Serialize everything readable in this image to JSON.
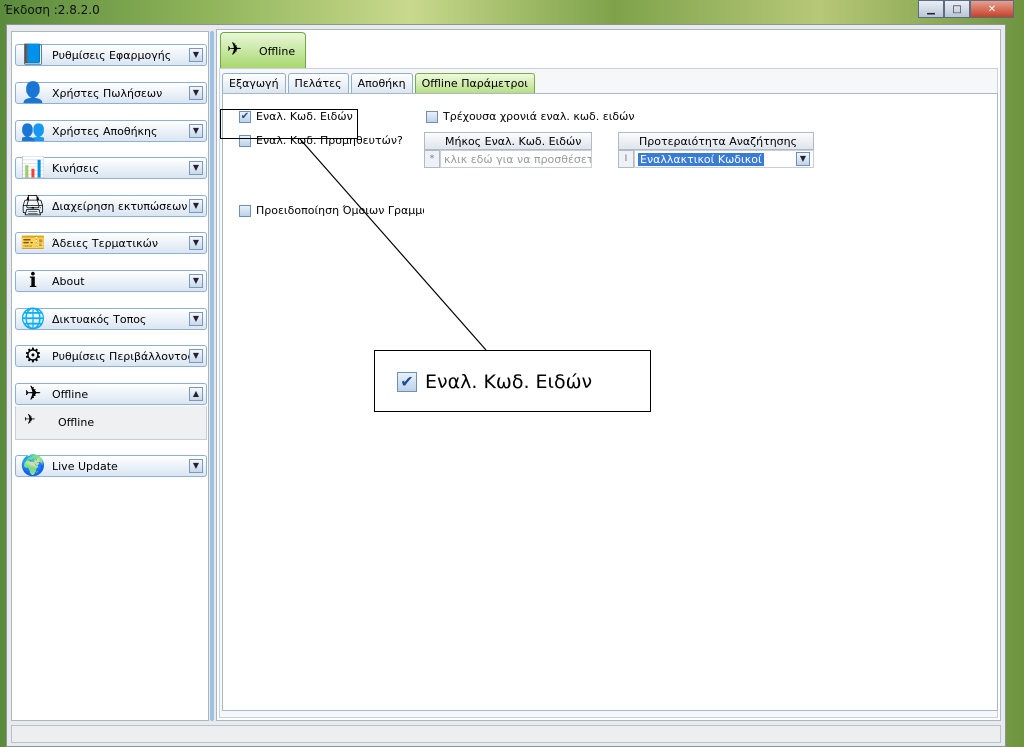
{
  "window": {
    "title": "Έκδοση :2.8.2.0",
    "minimize_glyph": "▁",
    "maximize_glyph": "□",
    "close_glyph": "✕"
  },
  "sidebar": {
    "items": [
      {
        "label": "Ρυθμίσεις Εφαρμογής",
        "icon": "settings-book-icon",
        "glyph": "📘"
      },
      {
        "label": "Χρήστες Πωλήσεων",
        "icon": "sales-user-icon",
        "glyph": "👤"
      },
      {
        "label": "Χρήστες Αποθήκης",
        "icon": "warehouse-users-icon",
        "glyph": "👥"
      },
      {
        "label": "Κινήσεις",
        "icon": "chart-icon",
        "glyph": "📊"
      },
      {
        "label": "Διαχείρηση εκτυπώσεων",
        "icon": "printer-icon",
        "glyph": "🖨"
      },
      {
        "label": "Άδειες Τερματικών",
        "icon": "license-icon",
        "glyph": "🎫"
      },
      {
        "label": "About",
        "icon": "info-icon",
        "glyph": "ℹ"
      },
      {
        "label": "Δικτυακός Τοπος",
        "icon": "web-icon",
        "glyph": "🌐"
      },
      {
        "label": "Ρυθμίσεις Περιβάλλοντος",
        "icon": "environment-settings-icon",
        "glyph": "⚙"
      },
      {
        "label": "Offline",
        "icon": "offline-icon",
        "glyph": "✈"
      },
      {
        "label": "Live Update",
        "icon": "globe-icon",
        "glyph": "🌍"
      }
    ],
    "expanded_sub": {
      "label": "Offline",
      "icon": "offline-small-icon",
      "glyph": "✈"
    },
    "chevron_down": "▼",
    "chevron_up": "▲"
  },
  "main": {
    "active_tab": {
      "label": "Offline",
      "glyph": "✈"
    },
    "sub_tabs": [
      "Εξαγωγή",
      "Πελάτες",
      "Αποθήκη",
      "Offline Παράμετροι"
    ],
    "checkboxes": {
      "alt_item_codes": {
        "label": "Εναλ. Κωδ. Ειδών",
        "checked": true
      },
      "alt_supplier_codes": {
        "label": "Εναλ. Κωδ. Προμηθευτών?",
        "checked": false
      },
      "similar_lines_warning": {
        "label": "Προειδοποίηση Όμοιων Γραμμών",
        "checked": false
      },
      "current_year_codes": {
        "label": "Τρέχουσα χρονιά εναλ. κωδ. ειδών",
        "checked": false
      }
    },
    "length_grid": {
      "header": "Μήκος Εναλ. Κωδ. Ειδών",
      "new_row_marker": "*",
      "new_row_placeholder": "κλικ εδώ για να προσθέσετε νέο"
    },
    "priority_grid": {
      "header": "Προτεραιότητα Αναζήτησης",
      "row_marker": "I",
      "selected_value": "Εναλλακτικοί Κωδικοί"
    },
    "check_glyph": "✔"
  },
  "callout": {
    "label": "Εναλ. Κωδ. Ειδών",
    "checked": true
  }
}
